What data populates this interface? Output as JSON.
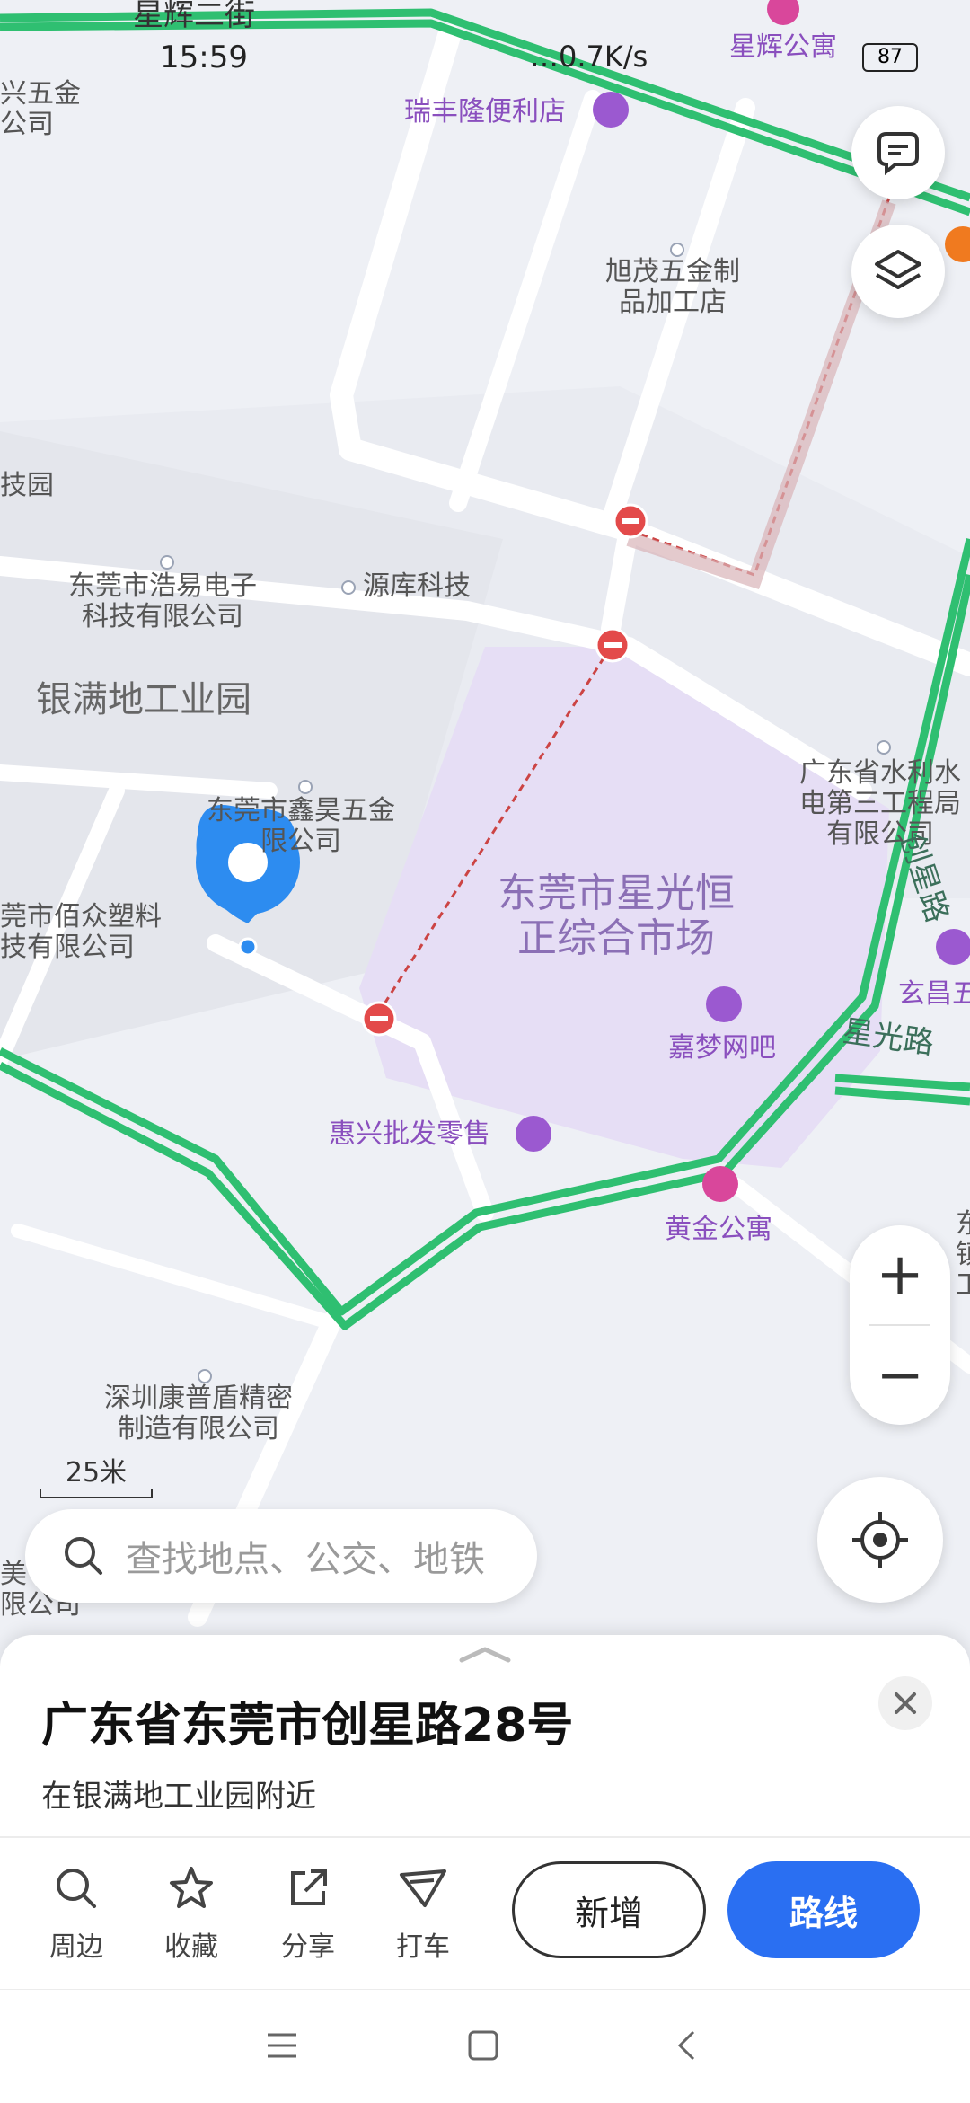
{
  "status_bar": {
    "time": "15:59",
    "indicators": "…0.7K/s",
    "battery": "87"
  },
  "map": {
    "streets": {
      "top_street": "星辉二街",
      "chuangxing_road": "创星路",
      "xingguang_road": "星光路"
    },
    "areas": {
      "industrial_park": "银满地工业园",
      "market": "东莞市星光恒\n正综合市场",
      "tech_park_partial": "技园",
      "hardware_partial": "兴五金\n公司"
    },
    "pois": {
      "ruifeng": "瑞丰隆便利店",
      "xumao": "旭茂五金制\n品加工店",
      "haoyi": "东莞市浩易电子\n科技有限公司",
      "yuanku": "源库科技",
      "xinhao": "东莞市鑫昊五金\n限公司",
      "baizhong": "莞市佰众塑料\n技有限公司",
      "gd_water": "广东省水利水\n电第三工程局\n有限公司",
      "jiameng": "嘉梦网吧",
      "huixing": "惠兴批发零售",
      "huangjin": "黄金公寓",
      "xuanchang": "玄昌五",
      "kangpudun": "深圳康普盾精密\n制造有限公司",
      "top_hotel": "星辉公寓",
      "right_partial": "东\n镇\n工",
      "left_bottom": "美\n限公司"
    },
    "scale_label": "25米"
  },
  "search": {
    "placeholder": "查找地点、公交、地铁"
  },
  "place_card": {
    "title": "广东省东莞市创星路28号",
    "subtitle": "在银满地工业园附近",
    "actions": [
      {
        "label": "周边",
        "icon": "search-icon"
      },
      {
        "label": "收藏",
        "icon": "star-icon"
      },
      {
        "label": "分享",
        "icon": "share-icon"
      },
      {
        "label": "打车",
        "icon": "taxi-icon"
      }
    ],
    "add_label": "新增",
    "route_label": "路线"
  },
  "colors": {
    "accent": "#2a6ff2",
    "road_green": "#2fbf71",
    "pin": "#2d8cf0",
    "market_area": "#e6def5"
  }
}
